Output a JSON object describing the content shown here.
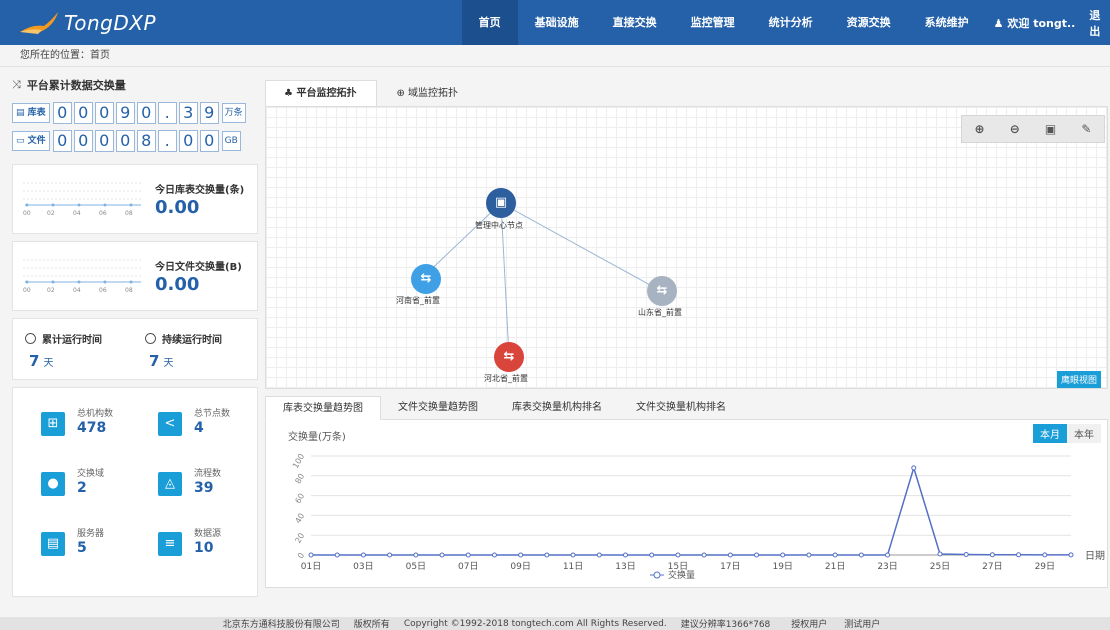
{
  "app": {
    "logo_text": "TongDXP"
  },
  "nav": {
    "items": [
      "首页",
      "基础设施",
      "直接交换",
      "监控管理",
      "统计分析",
      "资源交换",
      "系统维护"
    ],
    "active_index": 0,
    "user_label": "欢迎 tongt..",
    "logout_label": "退出"
  },
  "breadcrumb": "您所在的位置：首页",
  "left": {
    "title": "平台累计数据交换量",
    "counter_table": {
      "label": "库表",
      "digits": [
        "0",
        "0",
        "0",
        "9",
        "0",
        ".",
        "3",
        "9"
      ],
      "unit": "万条"
    },
    "counter_file": {
      "label": "文件",
      "digits": [
        "0",
        "0",
        "0",
        "0",
        "8",
        ".",
        "0",
        "0"
      ],
      "unit": "GB"
    },
    "today_table": {
      "label": "今日库表交换量(条)",
      "value": "0.00",
      "ticks": [
        "00",
        "02",
        "04",
        "06",
        "08"
      ]
    },
    "today_file": {
      "label": "今日文件交换量(B)",
      "value": "0.00",
      "ticks": [
        "00",
        "02",
        "04",
        "06",
        "08"
      ]
    },
    "runtime": {
      "total_label": "累计运行时间",
      "total_value": "7",
      "total_unit": "天",
      "continuous_label": "持续运行时间",
      "continuous_value": "7",
      "continuous_unit": "天"
    },
    "stats": [
      {
        "name": "总机构数",
        "value": "478",
        "icon": "org-chart-icon"
      },
      {
        "name": "总节点数",
        "value": "4",
        "icon": "share-nodes-icon"
      },
      {
        "name": "交换域",
        "value": "2",
        "icon": "location-user-icon"
      },
      {
        "name": "流程数",
        "value": "39",
        "icon": "workflow-icon"
      },
      {
        "name": "服务器",
        "value": "5",
        "icon": "server-icon"
      },
      {
        "name": "数据源",
        "value": "10",
        "icon": "database-icon"
      }
    ]
  },
  "topo_tabs": [
    "平台监控拓扑",
    "域监控拓扑"
  ],
  "topology": {
    "nodes": [
      {
        "name": "管理中心节点",
        "color": "#2d5f9e",
        "glyph": "▣"
      },
      {
        "name": "河南省_前置",
        "color": "#3fa0e6",
        "glyph": "⇆"
      },
      {
        "name": "山东省_前置",
        "color": "#a7b3c0",
        "glyph": "⇆"
      },
      {
        "name": "河北省_前置",
        "color": "#d9443b",
        "glyph": "⇆"
      }
    ],
    "eagle_label": "鹰眼视图"
  },
  "bottom_tabs": [
    "库表交换量趋势图",
    "文件交换量趋势图",
    "库表交换量机构排名",
    "文件交换量机构排名"
  ],
  "period_buttons": [
    "本月",
    "本年"
  ],
  "chart_data": {
    "type": "line",
    "ylabel": "交换量(万条)",
    "xlabel": "日期",
    "ylim": [
      0,
      100
    ],
    "yticks": [
      0,
      20,
      40,
      60,
      80,
      100
    ],
    "x": [
      "01日",
      "02日",
      "03日",
      "04日",
      "05日",
      "06日",
      "07日",
      "08日",
      "09日",
      "10日",
      "11日",
      "12日",
      "13日",
      "14日",
      "15日",
      "16日",
      "17日",
      "18日",
      "19日",
      "20日",
      "21日",
      "22日",
      "23日",
      "24日",
      "25日",
      "26日",
      "27日",
      "28日",
      "29日",
      "30日",
      "31日"
    ],
    "xticks_shown": [
      "01日",
      "03日",
      "05日",
      "07日",
      "09日",
      "11日",
      "13日",
      "15日",
      "17日",
      "19日",
      "21日",
      "23日",
      "25日",
      "27日",
      "29日"
    ],
    "series": [
      {
        "name": "交换量",
        "color": "#5470c6",
        "values": [
          0,
          0,
          0,
          0,
          0,
          0,
          0,
          0,
          0,
          0,
          0,
          0,
          0,
          0,
          0,
          0,
          0,
          0,
          0,
          0,
          0,
          0,
          0,
          88,
          1,
          0.5,
          0.3,
          0.2,
          0.1,
          0.1,
          0.1
        ]
      }
    ],
    "grid": true,
    "legend": "bottom"
  },
  "footer": {
    "company": "北京东方通科技股份有限公司",
    "rights": "版权所有",
    "copyright": "Copyright ©1992-2018 tongtech.com All Rights Reserved.",
    "resolution": "建议分辨率1366*768",
    "license": "授权用户",
    "license_user": "测试用户"
  }
}
